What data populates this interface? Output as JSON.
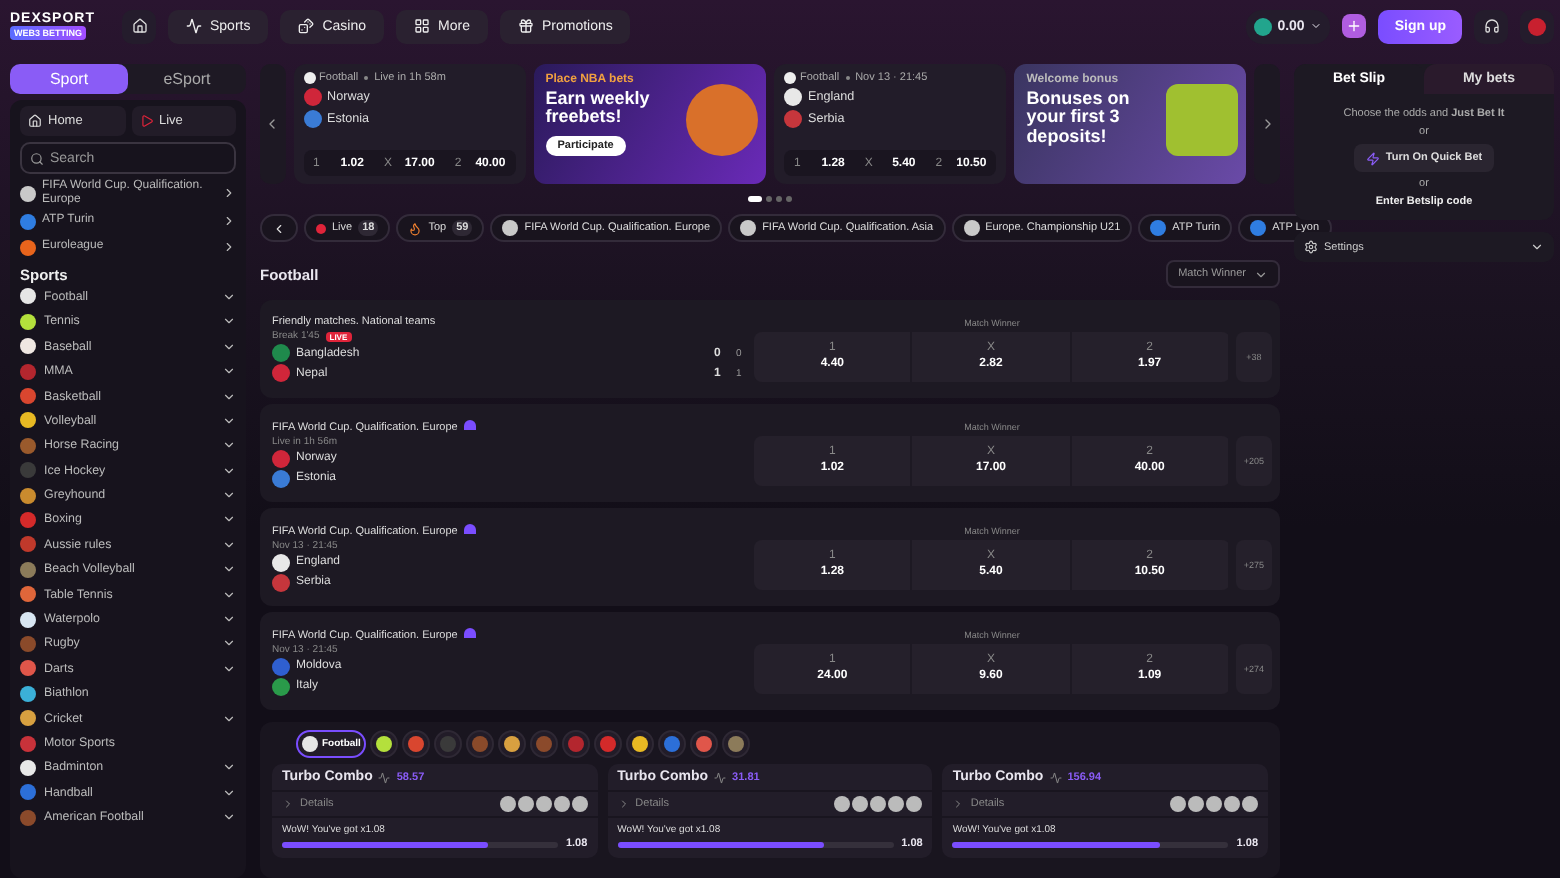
{
  "header": {
    "logo": "DEXSPORT",
    "tagline": "WEB3 BETTING",
    "nav": [
      {
        "label": "Sports"
      },
      {
        "label": "Casino"
      },
      {
        "label": "More"
      },
      {
        "label": "Promotions"
      }
    ],
    "balance": "0.00",
    "sign_up": "Sign up"
  },
  "sidebar": {
    "tabs": [
      {
        "label": "Sport",
        "selected": true
      },
      {
        "label": "eSport",
        "selected": false
      }
    ],
    "quick_links": [
      {
        "label": "Home"
      },
      {
        "label": "Live"
      }
    ],
    "search": {
      "placeholder": "Search"
    },
    "leagues": [
      {
        "label": "FIFA World Cup. Qualification. Europe",
        "color": "#c9c9c9"
      },
      {
        "label": "ATP Turin",
        "color": "#2f7de1"
      },
      {
        "label": "Euroleague",
        "color": "#e8641c"
      }
    ],
    "sports_heading": "Sports",
    "sports": [
      {
        "label": "Football",
        "color": "#e6e6e6",
        "expandable": true
      },
      {
        "label": "Tennis",
        "color": "#b4e03c",
        "expandable": true
      },
      {
        "label": "Baseball",
        "color": "#efe7e2",
        "expandable": true
      },
      {
        "label": "MMA",
        "color": "#b3262e",
        "expandable": true
      },
      {
        "label": "Basketball",
        "color": "#d9462f",
        "expandable": true
      },
      {
        "label": "Volleyball",
        "color": "#e8b923",
        "expandable": true
      },
      {
        "label": "Horse Racing",
        "color": "#9a5a2c",
        "expandable": true
      },
      {
        "label": "Ice Hockey",
        "color": "#3a3a3a",
        "expandable": true
      },
      {
        "label": "Greyhound",
        "color": "#c98b2e",
        "expandable": true
      },
      {
        "label": "Boxing",
        "color": "#d42a2a",
        "expandable": true
      },
      {
        "label": "Aussie rules",
        "color": "#c0392b",
        "expandable": true
      },
      {
        "label": "Beach Volleyball",
        "color": "#8c7b5a",
        "expandable": true
      },
      {
        "label": "Table Tennis",
        "color": "#e0663a",
        "expandable": true
      },
      {
        "label": "Waterpolo",
        "color": "#d8e6f2",
        "expandable": true
      },
      {
        "label": "Rugby",
        "color": "#8a4a2a",
        "expandable": true
      },
      {
        "label": "Darts",
        "color": "#e0564a",
        "expandable": true
      },
      {
        "label": "Biathlon",
        "color": "#3bb0d8",
        "expandable": false
      },
      {
        "label": "Cricket",
        "color": "#d8a040",
        "expandable": true
      },
      {
        "label": "Motor Sports",
        "color": "#c8323a",
        "expandable": false
      },
      {
        "label": "Badminton",
        "color": "#e8e8e8",
        "expandable": true
      },
      {
        "label": "Handball",
        "color": "#2c6fd8",
        "expandable": true
      },
      {
        "label": "American Football",
        "color": "#8b4a2b",
        "expandable": true
      }
    ]
  },
  "carousel": {
    "items": [
      {
        "kind": "match",
        "sport": "Football",
        "time": "Live in 1h 58m",
        "teams": [
          {
            "name": "Norway",
            "color": "#d0263a"
          },
          {
            "name": "Estonia",
            "color": "#3a7bd5"
          }
        ],
        "odds": [
          {
            "label": "1",
            "value": "1.02"
          },
          {
            "label": "X",
            "value": "17.00"
          },
          {
            "label": "2",
            "value": "40.00"
          }
        ]
      },
      {
        "kind": "promo",
        "eyebrow": "Place NBA bets",
        "title": "Earn weekly freebets!",
        "button": "Participate"
      },
      {
        "kind": "match",
        "sport": "Football",
        "time": "Nov 13 · 21:45",
        "teams": [
          {
            "name": "England",
            "color": "#e8e8e8"
          },
          {
            "name": "Serbia",
            "color": "#c6363c"
          }
        ],
        "odds": [
          {
            "label": "1",
            "value": "1.28"
          },
          {
            "label": "X",
            "value": "5.40"
          },
          {
            "label": "2",
            "value": "10.50"
          }
        ]
      },
      {
        "kind": "bonus",
        "eyebrow": "Welcome bonus",
        "title": "Bonuses on your first 3 deposits!"
      }
    ],
    "dots": [
      {
        "selected": true
      },
      {
        "selected": false
      },
      {
        "selected": false
      },
      {
        "selected": false
      }
    ]
  },
  "chips": [
    {
      "kind": "live",
      "label": "Live",
      "count": "18"
    },
    {
      "kind": "top",
      "label": "Top",
      "count": "59"
    },
    {
      "kind": "league",
      "label": "FIFA World Cup. Qualification. Europe"
    },
    {
      "kind": "league",
      "label": "FIFA World Cup. Qualification. Asia"
    },
    {
      "kind": "league",
      "label": "Europe. Championship U21"
    },
    {
      "kind": "tennis",
      "label": "ATP Turin"
    },
    {
      "kind": "tennis",
      "label": "ATP Lyon"
    }
  ],
  "section": {
    "title": "Football",
    "market": "Match Winner"
  },
  "events": [
    {
      "league": "Friendly matches. National teams",
      "status": "Break 1'45",
      "badge": "LIVE",
      "boosted": false,
      "teams": [
        {
          "name": "Bangladesh",
          "color": "#1f8a4c",
          "score": "0",
          "period": "0"
        },
        {
          "name": "Nepal",
          "color": "#d0263a",
          "score": "1",
          "period": "1"
        }
      ],
      "market": "Match Winner",
      "odds": [
        {
          "label": "1",
          "value": "4.40"
        },
        {
          "label": "X",
          "value": "2.82"
        },
        {
          "label": "2",
          "value": "1.97"
        }
      ],
      "more": "+38"
    },
    {
      "league": "FIFA World Cup. Qualification. Europe",
      "status": "Live in 1h 56m",
      "boosted": true,
      "teams": [
        {
          "name": "Norway",
          "color": "#d0263a"
        },
        {
          "name": "Estonia",
          "color": "#3a7bd5"
        }
      ],
      "market": "Match Winner",
      "odds": [
        {
          "label": "1",
          "value": "1.02"
        },
        {
          "label": "X",
          "value": "17.00"
        },
        {
          "label": "2",
          "value": "40.00"
        }
      ],
      "more": "+205"
    },
    {
      "league": "FIFA World Cup. Qualification. Europe",
      "status": "Nov 13 · 21:45",
      "boosted": true,
      "teams": [
        {
          "name": "England",
          "color": "#e8e8e8"
        },
        {
          "name": "Serbia",
          "color": "#c6363c"
        }
      ],
      "market": "Match Winner",
      "odds": [
        {
          "label": "1",
          "value": "1.28"
        },
        {
          "label": "X",
          "value": "5.40"
        },
        {
          "label": "2",
          "value": "10.50"
        }
      ],
      "more": "+275"
    },
    {
      "league": "FIFA World Cup. Qualification. Europe",
      "status": "Nov 13 · 21:45",
      "boosted": true,
      "teams": [
        {
          "name": "Moldova",
          "color": "#2f5fd0"
        },
        {
          "name": "Italy",
          "color": "#2a9a4a"
        }
      ],
      "market": "Match Winner",
      "odds": [
        {
          "label": "1",
          "value": "24.00"
        },
        {
          "label": "X",
          "value": "9.60"
        },
        {
          "label": "2",
          "value": "1.09"
        }
      ],
      "more": "+274"
    }
  ],
  "combos": {
    "sports": [
      {
        "label": "Football",
        "selected": true,
        "color": "#e6e6e6"
      },
      {
        "selected": false,
        "color": "#b4e03c"
      },
      {
        "selected": false,
        "color": "#d9462f"
      },
      {
        "selected": false,
        "color": "#3a3a3a"
      },
      {
        "selected": false,
        "color": "#8a4a2a"
      },
      {
        "selected": false,
        "color": "#d8a040"
      },
      {
        "selected": false,
        "color": "#8b4a2b"
      },
      {
        "selected": false,
        "color": "#b3262e"
      },
      {
        "selected": false,
        "color": "#d42a2a"
      },
      {
        "selected": false,
        "color": "#e8b923"
      },
      {
        "selected": false,
        "color": "#2c6fd8"
      },
      {
        "selected": false,
        "color": "#e0564a"
      },
      {
        "selected": false,
        "color": "#8c7b5a"
      }
    ],
    "cards": [
      {
        "title": "Turbo Combo",
        "total": "58.57",
        "details": "Details",
        "boost": "WoW! You've got x1.08",
        "level": 0.75,
        "multiplier": "1.08"
      },
      {
        "title": "Turbo Combo",
        "total": "31.81",
        "details": "Details",
        "boost": "WoW! You've got x1.08",
        "level": 0.75,
        "multiplier": "1.08"
      },
      {
        "title": "Turbo Combo",
        "total": "156.94",
        "details": "Details",
        "boost": "WoW! You've got x1.08",
        "level": 0.75,
        "multiplier": "1.08"
      }
    ]
  },
  "betslip": {
    "tabs": [
      {
        "label": "Bet Slip",
        "selected": true
      },
      {
        "label": "My bets",
        "selected": false
      }
    ],
    "prompt": "Choose the odds and **Just Bet It**",
    "or_1": "or",
    "quick_bet": "Turn On Quick Bet",
    "or_2": "or",
    "code": "Enter Betslip code",
    "settings": "Settings"
  }
}
